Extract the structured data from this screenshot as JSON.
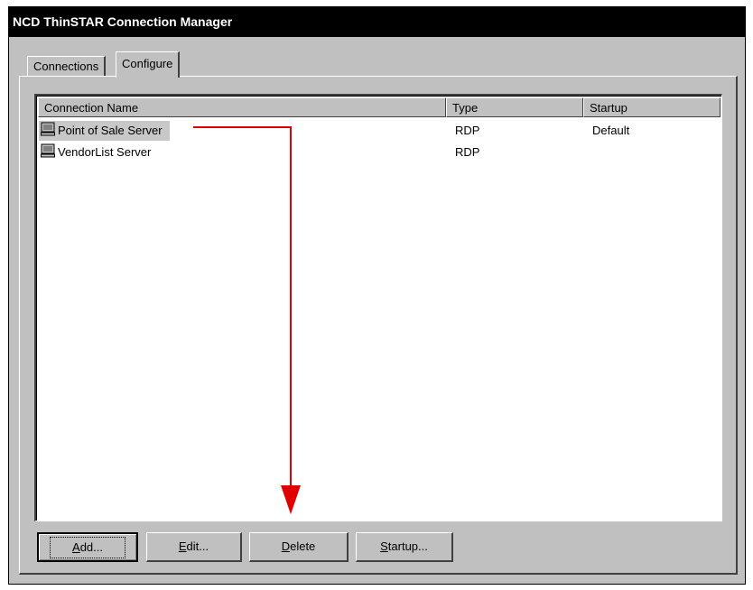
{
  "window": {
    "title": "NCD ThinSTAR Connection Manager"
  },
  "tabs": [
    {
      "label": "Connections",
      "active": false
    },
    {
      "label": "Configure",
      "active": true
    }
  ],
  "list": {
    "columns": [
      "Connection Name",
      "Type",
      "Startup"
    ],
    "rows": [
      {
        "name": "Point of Sale Server",
        "type": "RDP",
        "startup": "Default",
        "selected": true,
        "icon": "computer-icon"
      },
      {
        "name": "VendorList Server",
        "type": "RDP",
        "startup": "",
        "selected": false,
        "icon": "computer-icon"
      }
    ]
  },
  "buttons": {
    "add": {
      "label": "Add...",
      "accesskey": "A"
    },
    "edit": {
      "label": "Edit...",
      "accesskey": "E"
    },
    "delete": {
      "label": "Delete",
      "accesskey": "D"
    },
    "startup": {
      "label": "Startup...",
      "accesskey": "S"
    }
  },
  "colors": {
    "annotation_arrow": "#e00000",
    "titlebar": "#000000",
    "selection": "#c8c8c8"
  }
}
